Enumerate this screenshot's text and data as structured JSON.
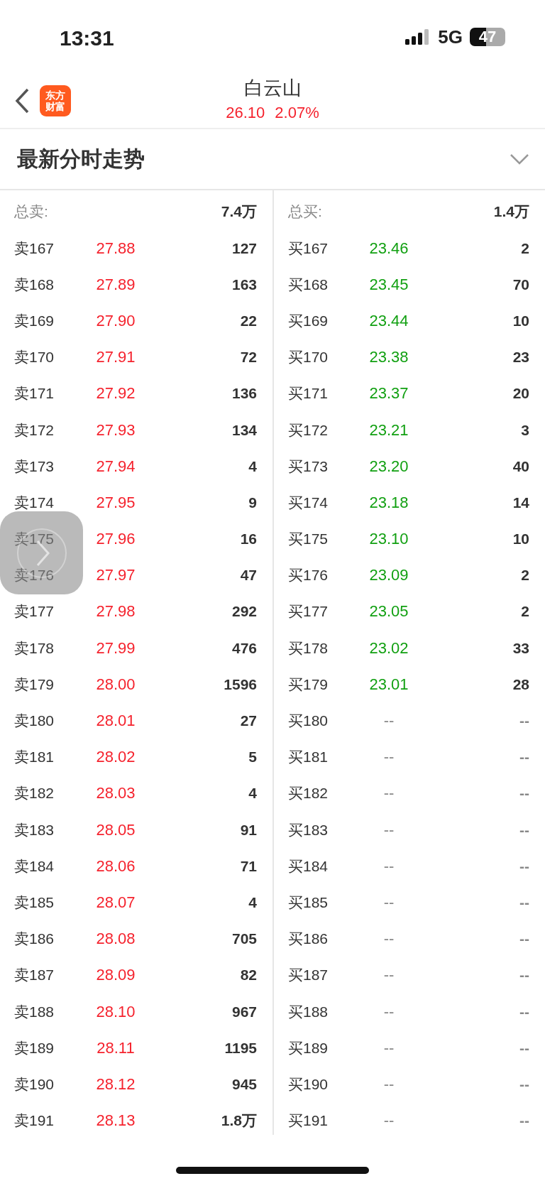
{
  "status_bar": {
    "time": "13:31",
    "network": "5G",
    "battery": "47"
  },
  "header": {
    "logo": [
      "东方",
      "财富"
    ],
    "title": "白云山",
    "price": "26.10",
    "change": "2.07%"
  },
  "section": {
    "title": "最新分时走势",
    "expanded": true
  },
  "book": [
    {
      "kind": "sell",
      "total_label": "总卖:",
      "total": "7.4万",
      "rows": [
        {
          "label": "卖167",
          "price": "27.88",
          "volume": "127"
        },
        {
          "label": "卖168",
          "price": "27.89",
          "volume": "163"
        },
        {
          "label": "卖169",
          "price": "27.90",
          "volume": "22"
        },
        {
          "label": "卖170",
          "price": "27.91",
          "volume": "72"
        },
        {
          "label": "卖171",
          "price": "27.92",
          "volume": "136"
        },
        {
          "label": "卖172",
          "price": "27.93",
          "volume": "134"
        },
        {
          "label": "卖173",
          "price": "27.94",
          "volume": "4"
        },
        {
          "label": "卖174",
          "price": "27.95",
          "volume": "9"
        },
        {
          "label": "卖175",
          "price": "27.96",
          "volume": "16"
        },
        {
          "label": "卖176",
          "price": "27.97",
          "volume": "47"
        },
        {
          "label": "卖177",
          "price": "27.98",
          "volume": "292"
        },
        {
          "label": "卖178",
          "price": "27.99",
          "volume": "476"
        },
        {
          "label": "卖179",
          "price": "28.00",
          "volume": "1596"
        },
        {
          "label": "卖180",
          "price": "28.01",
          "volume": "27"
        },
        {
          "label": "卖181",
          "price": "28.02",
          "volume": "5"
        },
        {
          "label": "卖182",
          "price": "28.03",
          "volume": "4"
        },
        {
          "label": "卖183",
          "price": "28.05",
          "volume": "91"
        },
        {
          "label": "卖184",
          "price": "28.06",
          "volume": "71"
        },
        {
          "label": "卖185",
          "price": "28.07",
          "volume": "4"
        },
        {
          "label": "卖186",
          "price": "28.08",
          "volume": "705"
        },
        {
          "label": "卖187",
          "price": "28.09",
          "volume": "82"
        },
        {
          "label": "卖188",
          "price": "28.10",
          "volume": "967"
        },
        {
          "label": "卖189",
          "price": "28.11",
          "volume": "1195"
        },
        {
          "label": "卖190",
          "price": "28.12",
          "volume": "945"
        },
        {
          "label": "卖191",
          "price": "28.13",
          "volume": "1.8万"
        }
      ]
    },
    {
      "kind": "buy",
      "total_label": "总买:",
      "total": "1.4万",
      "rows": [
        {
          "label": "买167",
          "price": "23.46",
          "volume": "2"
        },
        {
          "label": "买168",
          "price": "23.45",
          "volume": "70"
        },
        {
          "label": "买169",
          "price": "23.44",
          "volume": "10"
        },
        {
          "label": "买170",
          "price": "23.38",
          "volume": "23"
        },
        {
          "label": "买171",
          "price": "23.37",
          "volume": "20"
        },
        {
          "label": "买172",
          "price": "23.21",
          "volume": "3"
        },
        {
          "label": "买173",
          "price": "23.20",
          "volume": "40"
        },
        {
          "label": "买174",
          "price": "23.18",
          "volume": "14"
        },
        {
          "label": "买175",
          "price": "23.10",
          "volume": "10"
        },
        {
          "label": "买176",
          "price": "23.09",
          "volume": "2"
        },
        {
          "label": "买177",
          "price": "23.05",
          "volume": "2"
        },
        {
          "label": "买178",
          "price": "23.02",
          "volume": "33"
        },
        {
          "label": "买179",
          "price": "23.01",
          "volume": "28"
        },
        {
          "label": "买180",
          "price": "--",
          "volume": "--"
        },
        {
          "label": "买181",
          "price": "--",
          "volume": "--"
        },
        {
          "label": "买182",
          "price": "--",
          "volume": "--"
        },
        {
          "label": "买183",
          "price": "--",
          "volume": "--"
        },
        {
          "label": "买184",
          "price": "--",
          "volume": "--"
        },
        {
          "label": "买185",
          "price": "--",
          "volume": "--"
        },
        {
          "label": "买186",
          "price": "--",
          "volume": "--"
        },
        {
          "label": "买187",
          "price": "--",
          "volume": "--"
        },
        {
          "label": "买188",
          "price": "--",
          "volume": "--"
        },
        {
          "label": "买189",
          "price": "--",
          "volume": "--"
        },
        {
          "label": "买190",
          "price": "--",
          "volume": "--"
        },
        {
          "label": "买191",
          "price": "--",
          "volume": "--"
        }
      ]
    }
  ]
}
